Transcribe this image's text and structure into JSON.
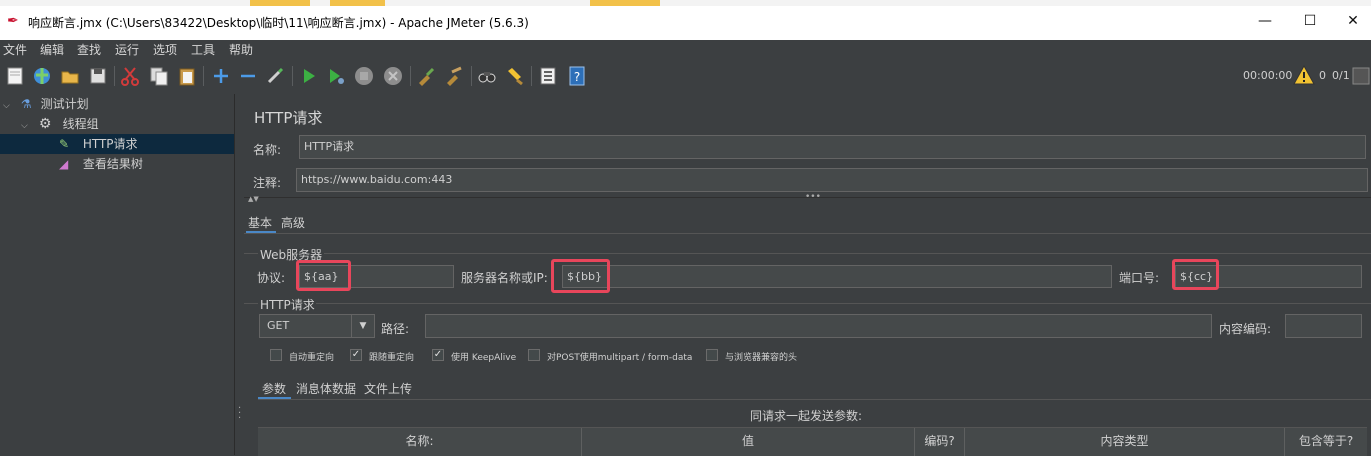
{
  "window": {
    "title": "响应断言.jmx (C:\\Users\\83422\\Desktop\\临时\\11\\响应断言.jmx) - Apache JMeter (5.6.3)",
    "minimize": "—",
    "maximize": "☐",
    "close": "✕"
  },
  "menu": [
    "文件",
    "编辑",
    "查找",
    "运行",
    "选项",
    "工具",
    "帮助"
  ],
  "toolbar": {
    "timer": "00:00:00",
    "warnings": "0",
    "threads": "0/1"
  },
  "tree": {
    "test_plan": "测试计划",
    "thread_group": "线程组",
    "http_request": "HTTP请求",
    "result_tree": "查看结果树"
  },
  "panel": {
    "title": "HTTP请求",
    "name_label": "名称:",
    "name_value": "HTTP请求",
    "comment_label": "注释:",
    "comment_value": "https://www.baidu.com:443"
  },
  "tabs": {
    "basic": "基本",
    "advanced": "高级"
  },
  "web_server": {
    "group_title": "Web服务器",
    "protocol_label": "协议:",
    "protocol_value": "${aa}",
    "server_label": "服务器名称或IP:",
    "server_value": "${bb}",
    "port_label": "端口号:",
    "port_value": "${cc}"
  },
  "http_request": {
    "group_title": "HTTP请求",
    "method": "GET",
    "path_label": "路径:",
    "path_value": "",
    "encoding_label": "内容编码:",
    "encoding_value": ""
  },
  "options": [
    {
      "label": "自动重定向",
      "checked": false
    },
    {
      "label": "跟随重定向",
      "checked": true
    },
    {
      "label": "使用 KeepAlive",
      "checked": true
    },
    {
      "label": "对POST使用multipart / form-data",
      "checked": false
    },
    {
      "label": "与浏览器兼容的头",
      "checked": false
    }
  ],
  "subtabs": {
    "params": "参数",
    "body": "消息体数据",
    "files": "文件上传"
  },
  "params_table": {
    "caption": "同请求一起发送参数:",
    "columns": [
      "名称:",
      "值",
      "编码?",
      "内容类型",
      "包含等于?"
    ]
  },
  "colors": {
    "background": "#3c3f41",
    "highlight": "#e8465b",
    "selection": "#0d293e"
  }
}
